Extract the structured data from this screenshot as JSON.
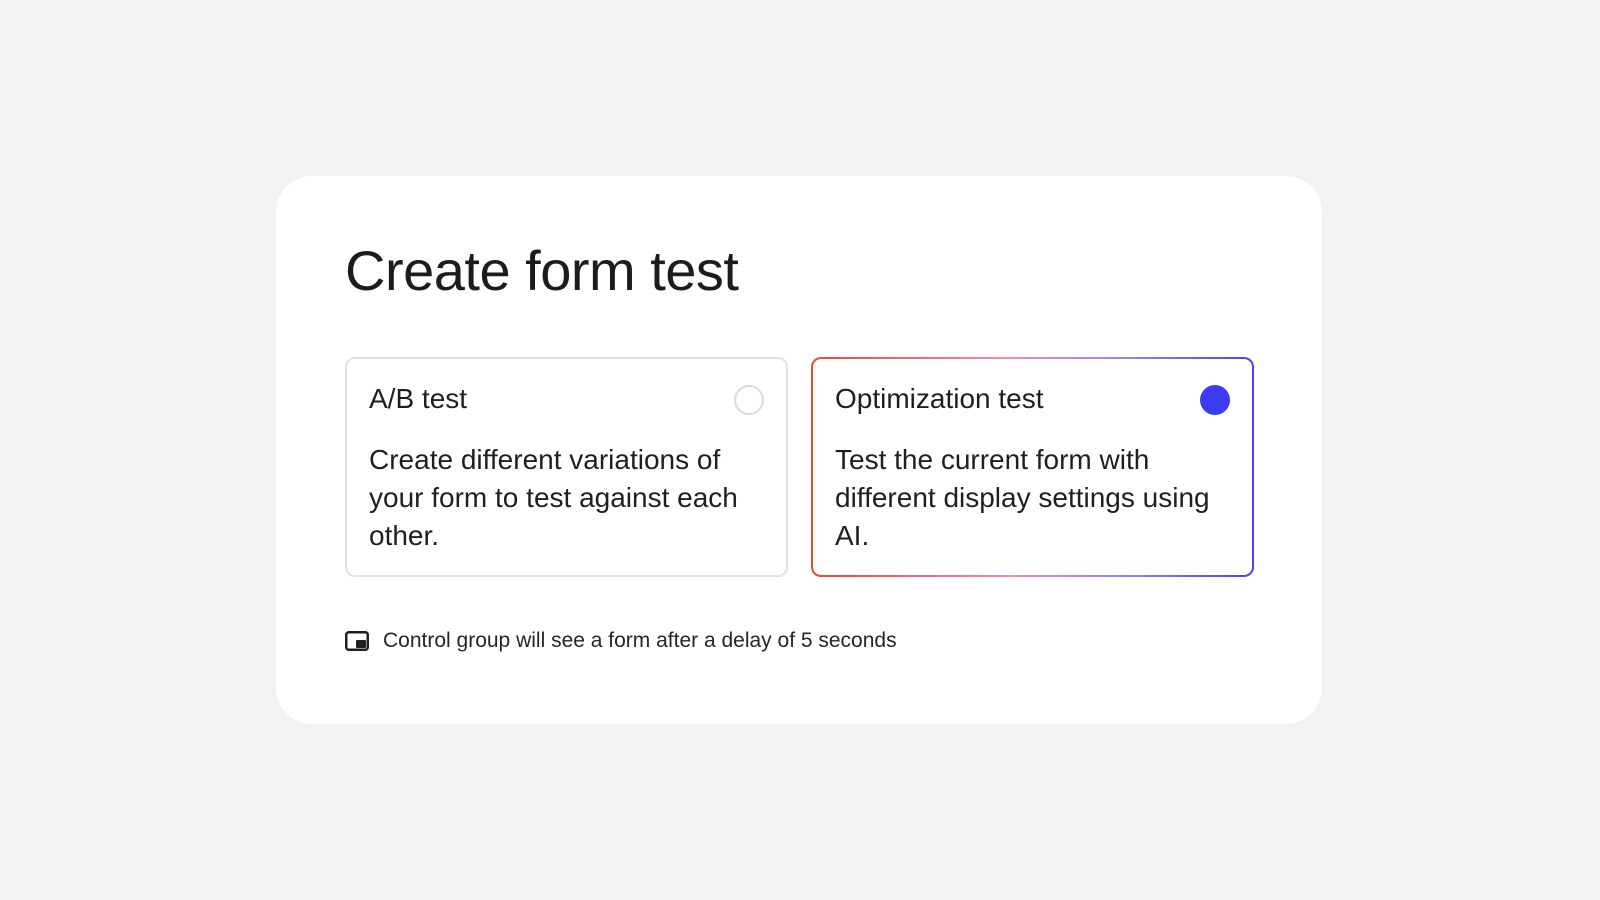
{
  "dialog": {
    "title": "Create form test",
    "options": [
      {
        "id": "ab",
        "title": "A/B test",
        "description": "Create different variations of your form to test against each other.",
        "selected": false
      },
      {
        "id": "optimization",
        "title": "Optimization test",
        "description": "Test the current form with different display settings using AI.",
        "selected": true
      }
    ],
    "note": {
      "icon": "picture-in-picture-icon",
      "text": "Control group will see a form after a delay of 5 seconds"
    }
  },
  "colors": {
    "background": "#f3f2f1",
    "card": "#ffffff",
    "accent": "#3a3cf6",
    "gradient_start": "#f0452e",
    "gradient_mid": "#f08ac2",
    "gradient_end": "#4a3ff5",
    "unselected_border": "#e2e1e0"
  }
}
